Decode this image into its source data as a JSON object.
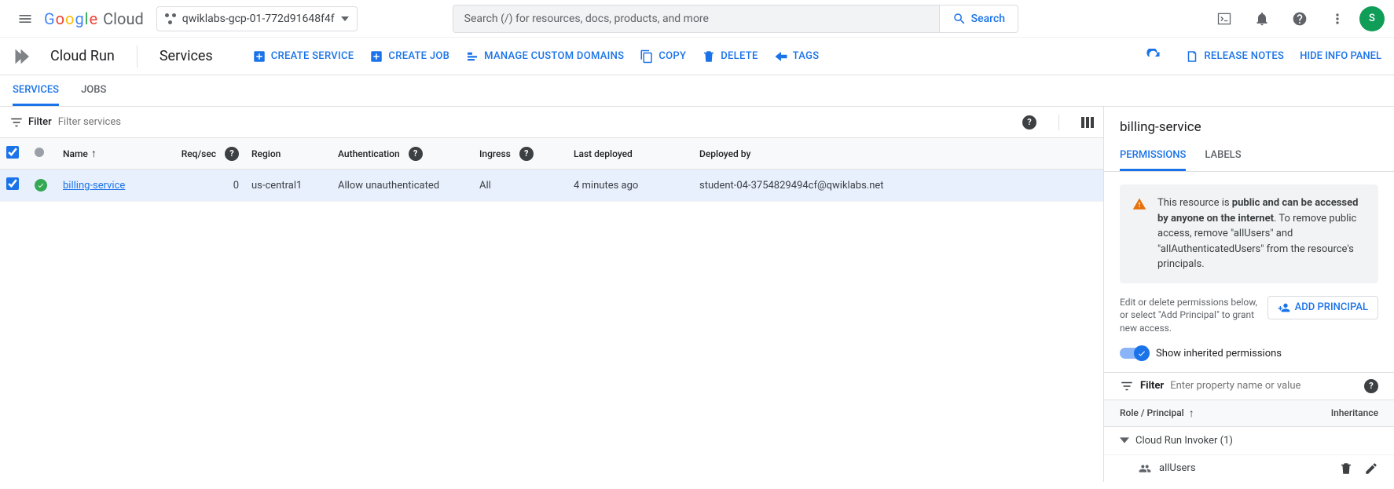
{
  "topbar": {
    "logo_cloud": "Cloud",
    "project": "qwiklabs-gcp-01-772d91648f4f",
    "search_placeholder": "Search (/) for resources, docs, products, and more",
    "search_button": "Search",
    "avatar_letter": "S"
  },
  "prodbar": {
    "product": "Cloud Run",
    "section": "Services",
    "actions": {
      "create_service": "CREATE SERVICE",
      "create_job": "CREATE JOB",
      "manage_domains": "MANAGE CUSTOM DOMAINS",
      "copy": "COPY",
      "delete": "DELETE",
      "tags": "TAGS"
    },
    "release_notes": "RELEASE NOTES",
    "hide_panel": "HIDE INFO PANEL"
  },
  "tabs": {
    "services": "SERVICES",
    "jobs": "JOBS"
  },
  "filter": {
    "label": "Filter",
    "placeholder": "Filter services"
  },
  "table": {
    "headers": {
      "name": "Name",
      "req": "Req/sec",
      "region": "Region",
      "auth": "Authentication",
      "ingress": "Ingress",
      "last_deployed": "Last deployed",
      "deployed_by": "Deployed by"
    },
    "row": {
      "name": "billing-service",
      "req": "0",
      "region": "us-central1",
      "auth": "Allow unauthenticated",
      "ingress": "All",
      "last_deployed": "4 minutes ago",
      "deployed_by": "student-04-3754829494cf@qwiklabs.net"
    }
  },
  "panel": {
    "title": "billing-service",
    "tabs": {
      "permissions": "PERMISSIONS",
      "labels": "LABELS"
    },
    "warn_pre": "This resource is ",
    "warn_bold": "public and can be accessed by anyone on the internet",
    "warn_post": ". To remove public access, remove \"allUsers\" and \"allAuthenticatedUsers\" from the resource's principals.",
    "edit_text": "Edit or delete permissions below, or select \"Add Principal\" to grant new access.",
    "add_principal": "ADD PRINCIPAL",
    "show_inherited": "Show inherited permissions",
    "filter_label": "Filter",
    "filter_placeholder": "Enter property name or value",
    "role_header": "Role / Principal",
    "inheritance_header": "Inheritance",
    "role_group": "Cloud Run Invoker (1)",
    "principal": "allUsers"
  }
}
